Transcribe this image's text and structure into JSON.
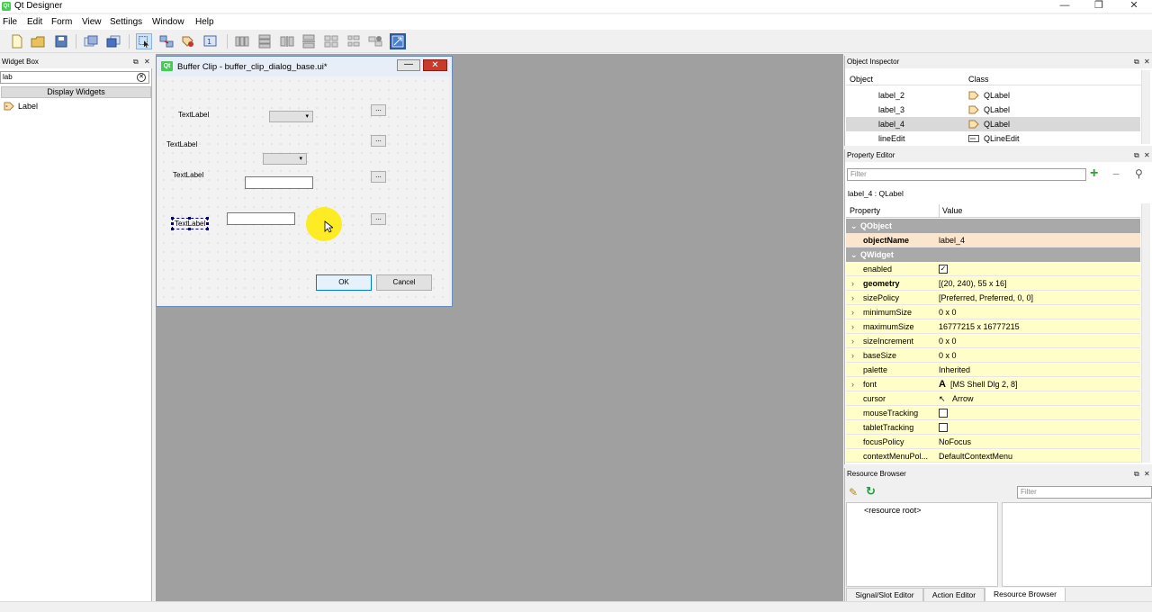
{
  "app": {
    "title": "Qt Designer",
    "icon_text": "Qt"
  },
  "window_controls": {
    "minimize": "—",
    "restore": "❐",
    "close": "✕"
  },
  "menu": [
    "File",
    "Edit",
    "Form",
    "View",
    "Settings",
    "Window",
    "Help"
  ],
  "widget_box": {
    "title": "Widget Box",
    "filter_value": "lab",
    "category": "Display Widgets",
    "items": [
      "Label"
    ]
  },
  "form": {
    "title": "Buffer Clip - buffer_clip_dialog_base.ui*",
    "qt_icon": "Qt",
    "min_glyph": "—",
    "close_glyph": "✕",
    "labels": [
      "TextLabel",
      "TextLabel",
      "TextLabel",
      "TextLabel"
    ],
    "browse": "...",
    "ok": "OK",
    "cancel": "Cancel"
  },
  "object_inspector": {
    "title": "Object Inspector",
    "col_object": "Object",
    "col_class": "Class",
    "rows": [
      {
        "object": "label_2",
        "class": "QLabel"
      },
      {
        "object": "label_3",
        "class": "QLabel"
      },
      {
        "object": "label_4",
        "class": "QLabel"
      },
      {
        "object": "lineEdit",
        "class": "QLineEdit"
      }
    ]
  },
  "property_editor": {
    "title": "Property Editor",
    "filter_placeholder": "Filter",
    "subject": "label_4 : QLabel",
    "col_property": "Property",
    "col_value": "Value",
    "cat_qobject": "QObject",
    "cat_qwidget": "QWidget",
    "object_name": {
      "name": "objectName",
      "value": "label_4"
    },
    "rows": [
      {
        "name": "enabled",
        "value": "",
        "arrow": ""
      },
      {
        "name": "geometry",
        "value": "[(20, 240), 55 x 16]",
        "arrow": "›"
      },
      {
        "name": "sizePolicy",
        "value": "[Preferred, Preferred, 0, 0]",
        "arrow": "›"
      },
      {
        "name": "minimumSize",
        "value": "0 x 0",
        "arrow": "›"
      },
      {
        "name": "maximumSize",
        "value": "16777215 x 16777215",
        "arrow": "›"
      },
      {
        "name": "sizeIncrement",
        "value": "0 x 0",
        "arrow": "›"
      },
      {
        "name": "baseSize",
        "value": "0 x 0",
        "arrow": "›"
      },
      {
        "name": "palette",
        "value": "Inherited",
        "arrow": ""
      },
      {
        "name": "font",
        "value": "[MS Shell Dlg 2, 8]",
        "arrow": "›"
      },
      {
        "name": "cursor",
        "value": "Arrow",
        "arrow": ""
      },
      {
        "name": "mouseTracking",
        "value": "",
        "arrow": ""
      },
      {
        "name": "tabletTracking",
        "value": "",
        "arrow": ""
      },
      {
        "name": "focusPolicy",
        "value": "NoFocus",
        "arrow": ""
      },
      {
        "name": "contextMenuPol...",
        "value": "DefaultContextMenu",
        "arrow": ""
      }
    ],
    "font_glyph": "A",
    "cursor_glyph": "↖"
  },
  "resource_browser": {
    "title": "Resource Browser",
    "filter_placeholder": "Filter",
    "root": "<resource root>",
    "tabs": [
      "Signal/Slot Editor",
      "Action Editor",
      "Resource Browser"
    ]
  },
  "colors": {
    "accent": "#0078d7",
    "selection": "#d9d9d9",
    "cat_gray": "#a9a9a9",
    "highlight_row": "#fbe6cd",
    "yellow_row": "#fffdc8"
  }
}
